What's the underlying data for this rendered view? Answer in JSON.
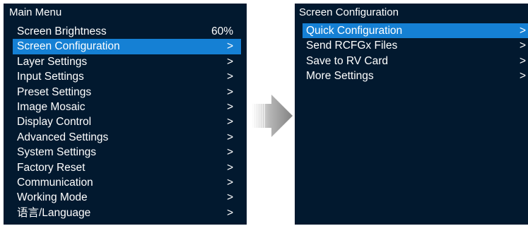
{
  "left_panel": {
    "title": "Main Menu",
    "items": [
      {
        "label": "Screen Brightness",
        "value": "60%"
      },
      {
        "label": "Screen Configuration",
        "value": ">"
      },
      {
        "label": "Layer Settings",
        "value": ">"
      },
      {
        "label": "Input Settings",
        "value": ">"
      },
      {
        "label": "Preset Settings",
        "value": ">"
      },
      {
        "label": "Image Mosaic",
        "value": ">"
      },
      {
        "label": "Display Control",
        "value": ">"
      },
      {
        "label": "Advanced Settings",
        "value": ">"
      },
      {
        "label": "System Settings",
        "value": ">"
      },
      {
        "label": "Factory Reset",
        "value": ">"
      },
      {
        "label": "Communication",
        "value": ">"
      },
      {
        "label": "Working Mode",
        "value": ">"
      },
      {
        "label": "语言/Language",
        "value": ">"
      }
    ]
  },
  "right_panel": {
    "title": "Screen Configuration",
    "items": [
      {
        "label": "Quick Configuration",
        "value": ">"
      },
      {
        "label": "Send RCFGx Files",
        "value": ">"
      },
      {
        "label": "Save to RV Card",
        "value": ">"
      },
      {
        "label": "More Settings",
        "value": ">"
      }
    ]
  },
  "colors": {
    "panel_background": "#02192f",
    "selection_highlight": "#1580d4",
    "text": "#ffffff",
    "arrow": "#8a8a8a"
  },
  "icons": {
    "transition": "right-arrow-icon"
  }
}
